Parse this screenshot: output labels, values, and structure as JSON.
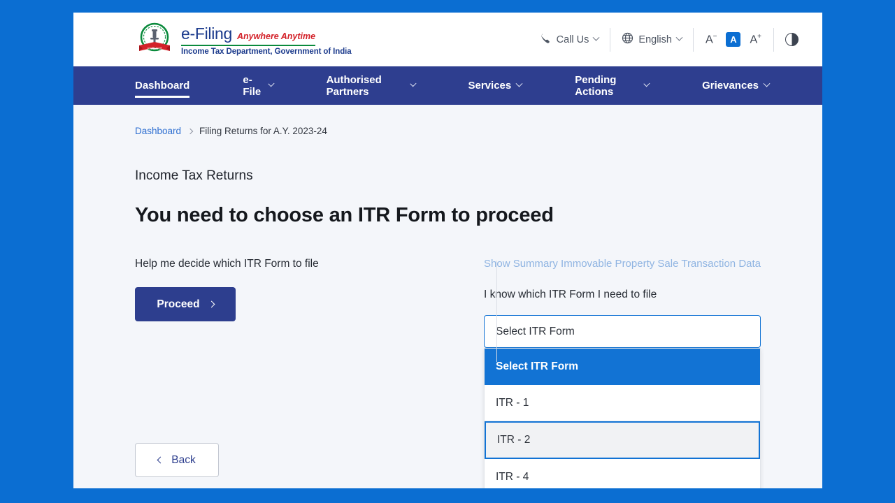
{
  "brand": {
    "emblem_icon": "india-emblem-icon",
    "title": "e-Filing",
    "tagline": "Anywhere Anytime",
    "department": "Income Tax Department, Government of India"
  },
  "header": {
    "call_us": {
      "label": "Call Us",
      "icon": "phone-icon",
      "chevron": "chevron-down-icon"
    },
    "language": {
      "label": "English",
      "icon": "globe-icon",
      "chevron": "chevron-down-icon"
    },
    "font_size": {
      "decrease_label": "A",
      "decrease_sup": "−",
      "normal_label": "A",
      "increase_label": "A",
      "increase_sup": "+",
      "active": "normal",
      "active_color": "#0b6ed2"
    },
    "contrast": {
      "icon": "contrast-icon",
      "label": ""
    }
  },
  "nav": {
    "items": [
      {
        "label": "Dashboard",
        "has_chevron": false,
        "active": true
      },
      {
        "label": "e-File",
        "has_chevron": true,
        "active": false
      },
      {
        "label": "Authorised Partners",
        "has_chevron": true,
        "active": false
      },
      {
        "label": "Services",
        "has_chevron": true,
        "active": false
      },
      {
        "label": "Pending Actions",
        "has_chevron": true,
        "active": false
      },
      {
        "label": "Grievances",
        "has_chevron": true,
        "active": false
      }
    ],
    "background": "#2e3e8f"
  },
  "breadcrumb": {
    "root": "Dashboard",
    "separator": "chevron-right-icon",
    "current": "Filing Returns for A.Y. 2023-24"
  },
  "main": {
    "section_title": "Income Tax Returns",
    "heading": "You need to choose an ITR Form to proceed",
    "left": {
      "help_text": "Help me decide which ITR Form to file",
      "proceed_label": "Proceed",
      "proceed_icon": "chevron-right-icon",
      "back_label": "Back",
      "back_icon": "chevron-left-icon"
    },
    "right": {
      "summary_link": "Show Summary Immovable Property Sale Transaction Data",
      "know_text": "I know which ITR Form I need to file",
      "select": {
        "value": "Select ITR Form",
        "placeholder": "Select ITR Form",
        "expanded": true,
        "options": [
          {
            "label": "Select ITR Form",
            "state": "selected"
          },
          {
            "label": "ITR - 1",
            "state": "normal"
          },
          {
            "label": "ITR - 2",
            "state": "focused"
          },
          {
            "label": "ITR - 4",
            "state": "normal"
          }
        ]
      }
    }
  },
  "colors": {
    "page_backdrop": "#0b6ed2",
    "navbar": "#2e3e8f",
    "primary_button": "#2d3e8e",
    "accent_blue": "#1273d4",
    "content_bg": "#f4f6fa"
  }
}
